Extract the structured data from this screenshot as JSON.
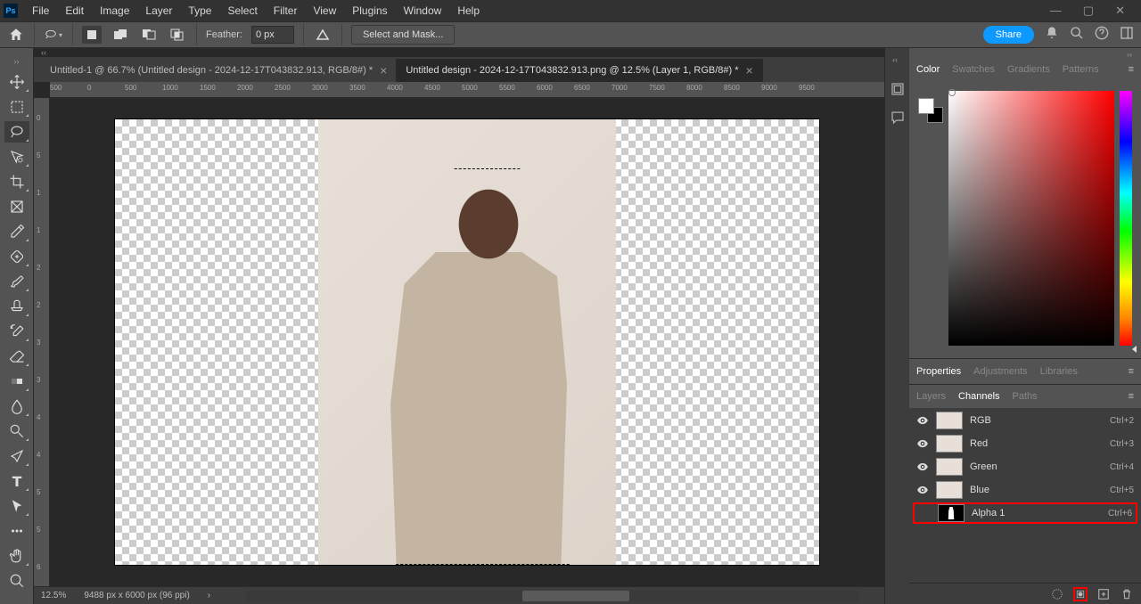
{
  "menu": {
    "items": [
      "File",
      "Edit",
      "Image",
      "Layer",
      "Type",
      "Select",
      "Filter",
      "View",
      "Plugins",
      "Window",
      "Help"
    ]
  },
  "option_bar": {
    "feather_label": "Feather:",
    "feather_value": "0 px",
    "select_mask": "Select and Mask...",
    "share": "Share"
  },
  "document_tabs": {
    "tab1": "Untitled-1 @ 66.7% (Untitled design - 2024-12-17T043832.913, RGB/8#) *",
    "tab2": "Untitled design - 2024-12-17T043832.913.png @ 12.5% (Layer 1, RGB/8#) *"
  },
  "ruler_h": [
    "500",
    "0",
    "500",
    "1000",
    "1500",
    "2000",
    "2500",
    "3000",
    "3500",
    "4000",
    "4500",
    "5000",
    "5500",
    "6000",
    "6500",
    "7000",
    "7500",
    "8000",
    "8500",
    "9000",
    "9500"
  ],
  "ruler_v": [
    "0",
    "5",
    "1",
    "1",
    "2",
    "2",
    "3",
    "3",
    "4",
    "4",
    "5",
    "5",
    "6"
  ],
  "status": {
    "zoom": "12.5%",
    "dims": "9488 px x 6000 px (96 ppi)"
  },
  "panels": {
    "color": {
      "tabs": [
        "Color",
        "Swatches",
        "Gradients",
        "Patterns"
      ]
    },
    "properties": {
      "tabs": [
        "Properties",
        "Adjustments",
        "Libraries"
      ]
    },
    "layers": {
      "tabs": [
        "Layers",
        "Channels",
        "Paths"
      ]
    }
  },
  "channels": [
    {
      "name": "RGB",
      "shortcut": "Ctrl+2",
      "visible": true,
      "alpha": false
    },
    {
      "name": "Red",
      "shortcut": "Ctrl+3",
      "visible": true,
      "alpha": false
    },
    {
      "name": "Green",
      "shortcut": "Ctrl+4",
      "visible": true,
      "alpha": false
    },
    {
      "name": "Blue",
      "shortcut": "Ctrl+5",
      "visible": true,
      "alpha": false
    },
    {
      "name": "Alpha 1",
      "shortcut": "Ctrl+6",
      "visible": false,
      "alpha": true
    }
  ]
}
